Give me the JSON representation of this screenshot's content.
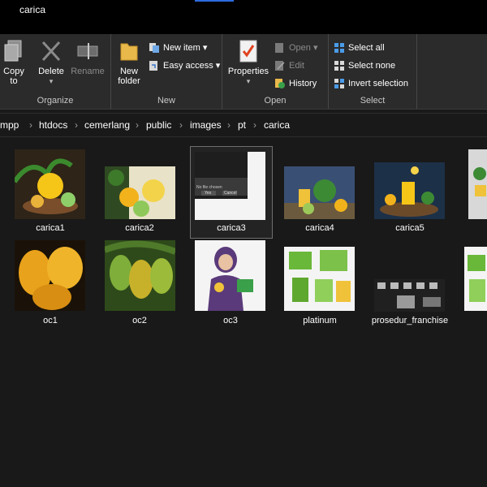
{
  "window": {
    "title": "carica"
  },
  "ribbon": {
    "organize": {
      "label": "Organize",
      "copy_to": "Copy to",
      "delete": "Delete",
      "rename": "Rename"
    },
    "new": {
      "label": "New",
      "new_folder": "New folder",
      "new_item": "New item ▾",
      "easy_access": "Easy access ▾"
    },
    "open": {
      "label": "Open",
      "properties": "Properties",
      "open": "Open ▾",
      "edit": "Edit",
      "history": "History"
    },
    "select": {
      "label": "Select",
      "select_all": "Select all",
      "select_none": "Select none",
      "invert_selection": "Invert selection"
    }
  },
  "address": {
    "crumbs": [
      "mpp",
      "htdocs",
      "cemerlang",
      "public",
      "images",
      "pt",
      "carica"
    ]
  },
  "files": [
    {
      "name": "carica1",
      "icon": "image-thumbnail"
    },
    {
      "name": "carica2",
      "icon": "image-thumbnail"
    },
    {
      "name": "carica3",
      "icon": "image-thumbnail",
      "selected": true,
      "thumb_text": {
        "t1": "No file chosen",
        "t2": "Yes",
        "t3": "Cancel"
      }
    },
    {
      "name": "carica4",
      "icon": "image-thumbnail"
    },
    {
      "name": "carica5",
      "icon": "image-thumbnail"
    },
    {
      "name": "oc1",
      "icon": "image-thumbnail"
    },
    {
      "name": "oc2",
      "icon": "image-thumbnail"
    },
    {
      "name": "oc3",
      "icon": "image-thumbnail"
    },
    {
      "name": "platinum",
      "icon": "image-thumbnail"
    },
    {
      "name": "prosedur_franchise",
      "icon": "image-thumbnail"
    }
  ]
}
